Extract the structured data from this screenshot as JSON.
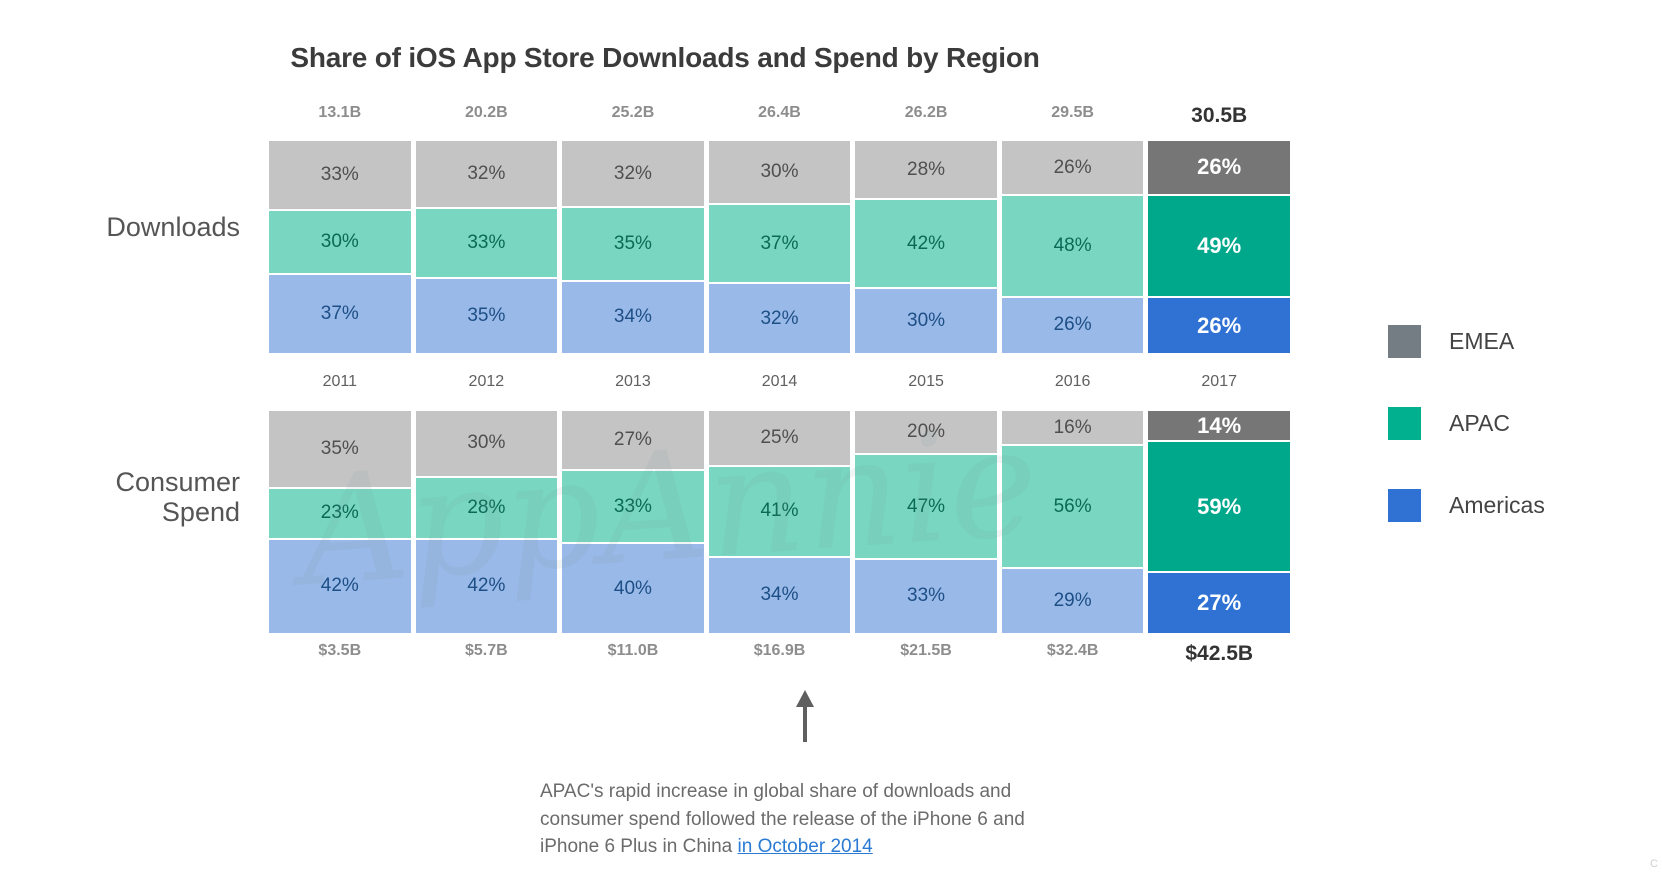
{
  "title": "Share of iOS App Store Downloads and Spend by Region",
  "watermark": "AppAnnie",
  "row_labels": {
    "downloads": "Downloads",
    "consumer_spend_line1": "Consumer",
    "consumer_spend_line2": "Spend"
  },
  "legend": {
    "items": [
      {
        "label": "EMEA",
        "color": "#747d84"
      },
      {
        "label": "APAC",
        "color": "#00b08f"
      },
      {
        "label": "Americas",
        "color": "#2f72d4"
      }
    ]
  },
  "annotation": {
    "line1": "APAC's rapid increase in global share of downloads and",
    "line2": "consumer spend followed the release of the iPhone 6 and",
    "line3_prefix": "iPhone 6 Plus in China ",
    "link_text": "in October 2014",
    "arrow_points_to": "2014"
  },
  "corner_mark": "C",
  "chart_data": {
    "type": "bar",
    "title": "Share of iOS App Store Downloads and Spend by Region",
    "xlabel": "",
    "ylabel": "",
    "grid": false,
    "legend_position": "right",
    "categories": [
      "2011",
      "2012",
      "2013",
      "2014",
      "2015",
      "2016",
      "2017"
    ],
    "highlight_category": "2017",
    "panels": [
      {
        "name": "Downloads",
        "totals_label_position": "top",
        "totals": [
          "13.1B",
          "20.2B",
          "25.2B",
          "26.4B",
          "26.2B",
          "29.5B",
          "30.5B"
        ],
        "totals_numeric": [
          13.1,
          20.2,
          25.2,
          26.4,
          26.2,
          29.5,
          30.5
        ],
        "totals_unit": "B downloads",
        "series": [
          {
            "name": "EMEA",
            "color": "#c4c4c4",
            "highlight_color": "#767676",
            "values": [
              33,
              32,
              32,
              30,
              28,
              26,
              26
            ],
            "labels": [
              "33%",
              "32%",
              "32%",
              "30%",
              "28%",
              "26%",
              "26%"
            ]
          },
          {
            "name": "APAC",
            "color": "#78d6c1",
            "highlight_color": "#00a88b",
            "values": [
              30,
              33,
              35,
              37,
              42,
              48,
              49
            ],
            "labels": [
              "30%",
              "33%",
              "35%",
              "37%",
              "42%",
              "48%",
              "49%"
            ]
          },
          {
            "name": "Americas",
            "color": "#99b9e8",
            "highlight_color": "#2f72d4",
            "values": [
              37,
              35,
              34,
              32,
              30,
              26,
              26
            ],
            "labels": [
              "37%",
              "35%",
              "34%",
              "32%",
              "30%",
              "26%",
              "26%"
            ]
          }
        ]
      },
      {
        "name": "Consumer Spend",
        "totals_label_position": "bottom",
        "totals": [
          "$3.5B",
          "$5.7B",
          "$11.0B",
          "$16.9B",
          "$21.5B",
          "$32.4B",
          "$42.5B"
        ],
        "totals_numeric": [
          3.5,
          5.7,
          11.0,
          16.9,
          21.5,
          32.4,
          42.5
        ],
        "totals_unit": "B USD",
        "series": [
          {
            "name": "EMEA",
            "color": "#c4c4c4",
            "highlight_color": "#767676",
            "values": [
              35,
              30,
              27,
              25,
              20,
              16,
              14
            ],
            "labels": [
              "35%",
              "30%",
              "27%",
              "25%",
              "20%",
              "16%",
              "14%"
            ]
          },
          {
            "name": "APAC",
            "color": "#78d6c1",
            "highlight_color": "#00a88b",
            "values": [
              23,
              28,
              33,
              41,
              47,
              56,
              59
            ],
            "labels": [
              "23%",
              "28%",
              "33%",
              "41%",
              "47%",
              "56%",
              "59%"
            ]
          },
          {
            "name": "Americas",
            "color": "#99b9e8",
            "highlight_color": "#2f72d4",
            "values": [
              42,
              42,
              40,
              34,
              33,
              29,
              27
            ],
            "labels": [
              "42%",
              "42%",
              "40%",
              "34%",
              "33%",
              "29%",
              "27%"
            ]
          }
        ]
      }
    ]
  }
}
